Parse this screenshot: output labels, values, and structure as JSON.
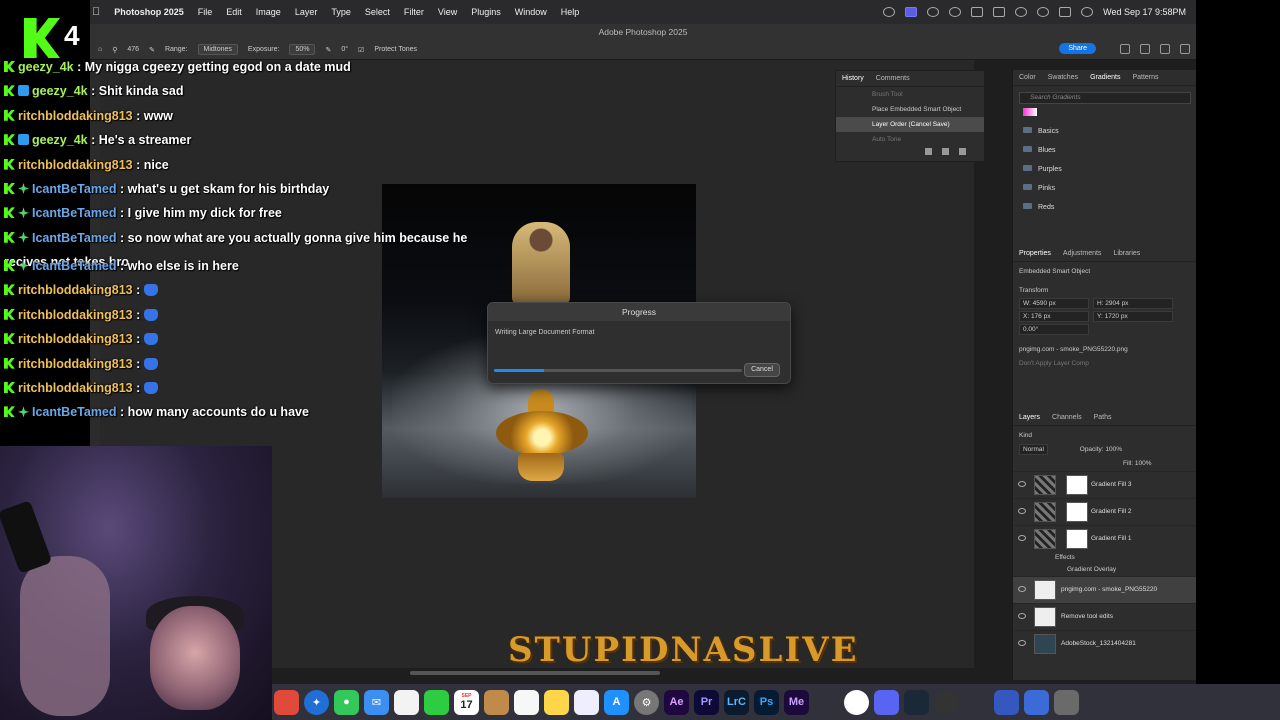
{
  "menubar": {
    "app_name": "Photoshop 2025",
    "items": [
      "File",
      "Edit",
      "Image",
      "Layer",
      "Type",
      "Select",
      "Filter",
      "View",
      "Plugins",
      "Window",
      "Help"
    ],
    "datetime": "Wed Sep 17  9:58PM"
  },
  "window": {
    "title": "Adobe Photoshop 2025"
  },
  "options_bar": {
    "range_label": "Range:",
    "range_value": "Midtones",
    "exposure_label": "Exposure:",
    "exposure_value": "50%",
    "angle_value": "0°",
    "protect_tones": "Protect Tones",
    "brush_size": "476",
    "share_label": "Share"
  },
  "history_panel": {
    "tabs": [
      "History",
      "Comments"
    ],
    "rows": [
      "Brush Tool",
      "Place Embedded Smart Object",
      "Layer Order (Cancel Save)",
      "Auto Tone"
    ]
  },
  "progress_dialog": {
    "title": "Progress",
    "message": "Writing Large Document Format",
    "progress_fraction": 0.2,
    "cancel_label": "Cancel"
  },
  "gradients_panel": {
    "tabs": [
      "Color",
      "Swatches",
      "Gradients",
      "Patterns"
    ],
    "search_placeholder": "Search Gradients",
    "folders": [
      "Basics",
      "Blues",
      "Purples",
      "Pinks",
      "Reds"
    ]
  },
  "properties_panel": {
    "tabs": [
      "Properties",
      "Adjustments",
      "Libraries"
    ],
    "object_type": "Embedded Smart Object",
    "transform_label": "Transform",
    "w": "W: 4590 px",
    "h": "H: 2904 px",
    "x": "X: 176 px",
    "y": "Y: 1720 px",
    "angle": "0.00°",
    "filename": "pngimg.com - smoke_PNG55220.png",
    "layer_comp": "Don't Apply Layer Comp"
  },
  "layers_panel": {
    "tabs": [
      "Layers",
      "Channels",
      "Paths"
    ],
    "filter_kind": "Kind",
    "blend_mode": "Normal",
    "opacity_label": "Opacity:",
    "opacity_value": "100%",
    "fill_label": "Fill:",
    "fill_value": "100%",
    "layers": [
      "Gradient Fill 3",
      "Gradient Fill 2",
      "Gradient Fill 1"
    ],
    "effects_label": "Effects",
    "gradient_overlay_label": "Gradient Overlay",
    "layers_bottom": [
      "pngimg.com - smoke_PNG55220",
      "Remove tool edits",
      "AdobeStock_1321404281"
    ]
  },
  "stream": {
    "viewer_count": "4",
    "chat": [
      {
        "user": "geezy_4k",
        "color": "#a6f05c",
        "text": ": My nigga cgeezy getting egod on a date mud",
        "badge": "k"
      },
      {
        "user": "geezy_4k",
        "color": "#a6f05c",
        "text": ": Shit kinda sad",
        "badge": "kq"
      },
      {
        "user": "ritchbloddaking813",
        "color": "#f0c058",
        "text": ": www",
        "badge": "k"
      },
      {
        "user": "geezy_4k",
        "color": "#a6f05c",
        "text": ": He's a streamer",
        "badge": "kq"
      },
      {
        "user": "ritchbloddaking813",
        "color": "#f0c058",
        "text": ": nice",
        "badge": "k"
      },
      {
        "user": "IcantBeTamed",
        "color": "#6aa7e8",
        "text": ": what's u get skam for his birthday",
        "badge": "kg"
      },
      {
        "user": "IcantBeTamed",
        "color": "#6aa7e8",
        "text": ": I give him my dick for free",
        "badge": "kg"
      },
      {
        "user": "IcantBeTamed",
        "color": "#6aa7e8",
        "text": ": so now what are you actually gonna give him because he",
        "badge": "kg"
      },
      {
        "user": "",
        "color": "#ffffff",
        "text": "recives not takes bro",
        "badge": ""
      },
      {
        "user": "IcantBeTamed",
        "color": "#6aa7e8",
        "text": ": who else is in here",
        "badge": "kg"
      },
      {
        "user": "ritchbloddaking813",
        "color": "#f0c058",
        "text": ":",
        "badge": "k",
        "emote": true
      },
      {
        "user": "ritchbloddaking813",
        "color": "#f0c058",
        "text": ":",
        "badge": "k",
        "emote": true
      },
      {
        "user": "ritchbloddaking813",
        "color": "#f0c058",
        "text": ":",
        "badge": "k",
        "emote": true
      },
      {
        "user": "ritchbloddaking813",
        "color": "#f0c058",
        "text": ":",
        "badge": "k",
        "emote": true
      },
      {
        "user": "ritchbloddaking813",
        "color": "#f0c058",
        "text": ":",
        "badge": "k",
        "emote": true
      },
      {
        "user": "IcantBeTamed",
        "color": "#6aa7e8",
        "text": ": how many accounts do u have",
        "badge": "kg"
      }
    ],
    "banner": "STUPIDNASLIVE"
  },
  "dock": {
    "labeled": [
      "Ae",
      "Pr",
      "LrC",
      "Ps",
      "Me"
    ],
    "calendar_day": "17",
    "calendar_month": "SEP"
  }
}
